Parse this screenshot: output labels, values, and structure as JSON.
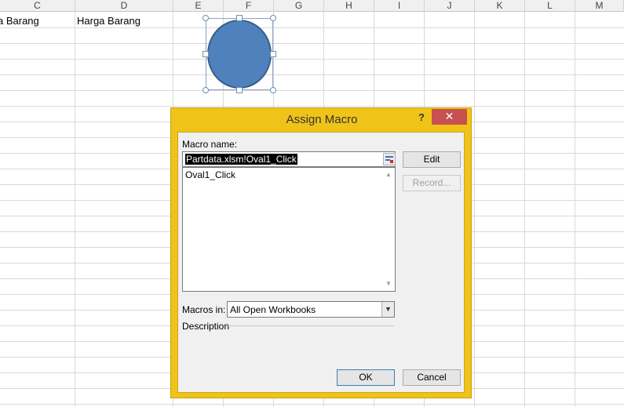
{
  "sheet": {
    "columns": [
      "C",
      "D",
      "E",
      "F",
      "G",
      "H",
      "I",
      "J",
      "K",
      "L",
      "M"
    ],
    "cells": {
      "c1": "a Barang",
      "d1": "Harga Barang"
    }
  },
  "dialog": {
    "title": "Assign Macro",
    "help_glyph": "?",
    "close_glyph": "✕",
    "macro_name_label": "Macro name:",
    "macro_name_value": "Partdata.xlsm!Oval1_Click",
    "macro_list": [
      "Oval1_Click"
    ],
    "buttons": {
      "edit": "Edit",
      "record": "Record...",
      "ok": "OK",
      "cancel": "Cancel"
    },
    "macros_in_label": "Macros in:",
    "macros_in_value": "All Open Workbooks",
    "description_label": "Description"
  },
  "colors": {
    "dialog_frame": "#f0c319",
    "close_button": "#c75050",
    "oval_fill": "#4f81bd"
  }
}
